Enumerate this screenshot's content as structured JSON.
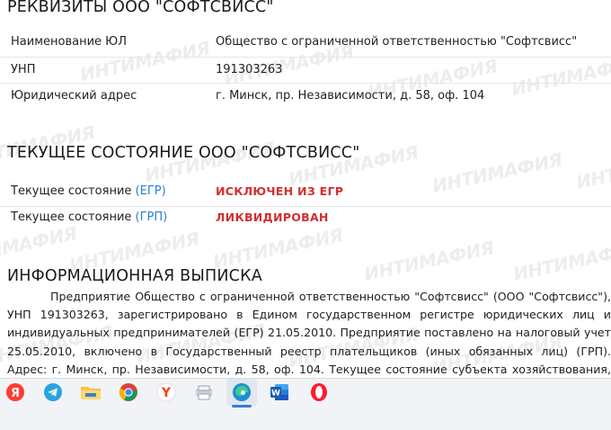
{
  "watermark": "ИНТИМАФИЯ",
  "requisites": {
    "title": "РЕКВИЗИТЫ ООО \"СОФТСВИСС\"",
    "rows": [
      {
        "label": "Наименование ЮЛ",
        "value": "Общество с ограниченной ответственностью \"Софтсвисс\""
      },
      {
        "label": "УНП",
        "value": "191303263"
      },
      {
        "label": "Юридический адрес",
        "value": "г. Минск, пр. Независимости, д. 58, оф. 104"
      }
    ]
  },
  "status": {
    "title": "ТЕКУЩЕЕ СОСТОЯНИЕ ООО \"СОФТСВИСС\"",
    "rows": [
      {
        "label": "Текущее состояние",
        "source": "(ЕГР)",
        "value": "ИСКЛЮЧЕН ИЗ ЕГР"
      },
      {
        "label": "Текущее состояние",
        "source": "(ГРП)",
        "value": "ЛИКВИДИРОВАН"
      }
    ],
    "value_color": "#d32f2f",
    "link_color": "#2a7ed8"
  },
  "info": {
    "title": "ИНФОРМАЦИОННАЯ ВЫПИСКА",
    "text": "Предприятие Общество с ограниченной ответственностью \"Софтсвисс\" (ООО \"Софтсвисс\"), УНП 191303263, зарегистрировано в Едином государственном регистре юридических лиц и индивидуальных предпринимателей (ЕГР) 21.05.2010. Предприятие поставлено на налоговый учет 25.05.2010, включено в Государственный реестр плательщиков (иных обязанных лиц) (ГРП). Адрес: г. Минск, пр. Независимости, д. 58, оф. 104. Текущее состояние субъекта хозяйствования, согласно ЕГР, - \"Исключен из ЕГР\". Текущее"
  },
  "taskbar": {
    "apps": [
      {
        "name": "yandex-browser-icon"
      },
      {
        "name": "telegram-icon"
      },
      {
        "name": "file-explorer-icon"
      },
      {
        "name": "chrome-icon"
      },
      {
        "name": "yandex-icon"
      },
      {
        "name": "app-icon"
      },
      {
        "name": "edge-icon",
        "active": true
      },
      {
        "name": "word-icon",
        "letter": "W"
      },
      {
        "name": "opera-icon"
      }
    ]
  }
}
